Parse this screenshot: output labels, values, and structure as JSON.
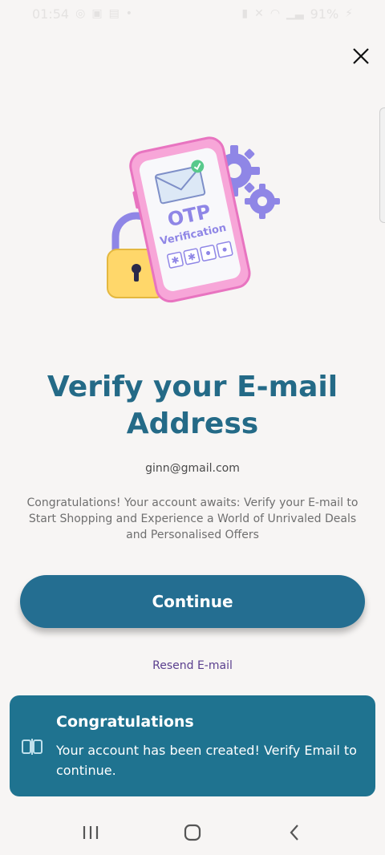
{
  "status_bar": {
    "time": "01:54",
    "battery": "91%"
  },
  "page": {
    "title": "Verify your E-mail Address",
    "email": "ginn@gmail.com",
    "description": "Congratulations! Your account awaits: Verify your E-mail to Start Shopping and Experience a World of Unrivaled Deals and Personalised Offers"
  },
  "illustration": {
    "otp_label": "OTP",
    "verification_label": "Verification"
  },
  "actions": {
    "continue_label": "Continue",
    "resend_label": "Resend E-mail"
  },
  "toast": {
    "title": "Congratulations",
    "message": "Your account has been created! Verify Email to continue."
  },
  "colors": {
    "primary": "#246e91",
    "title": "#246a87",
    "link": "#5a3f8e",
    "toast_bg": "#1f7390"
  }
}
